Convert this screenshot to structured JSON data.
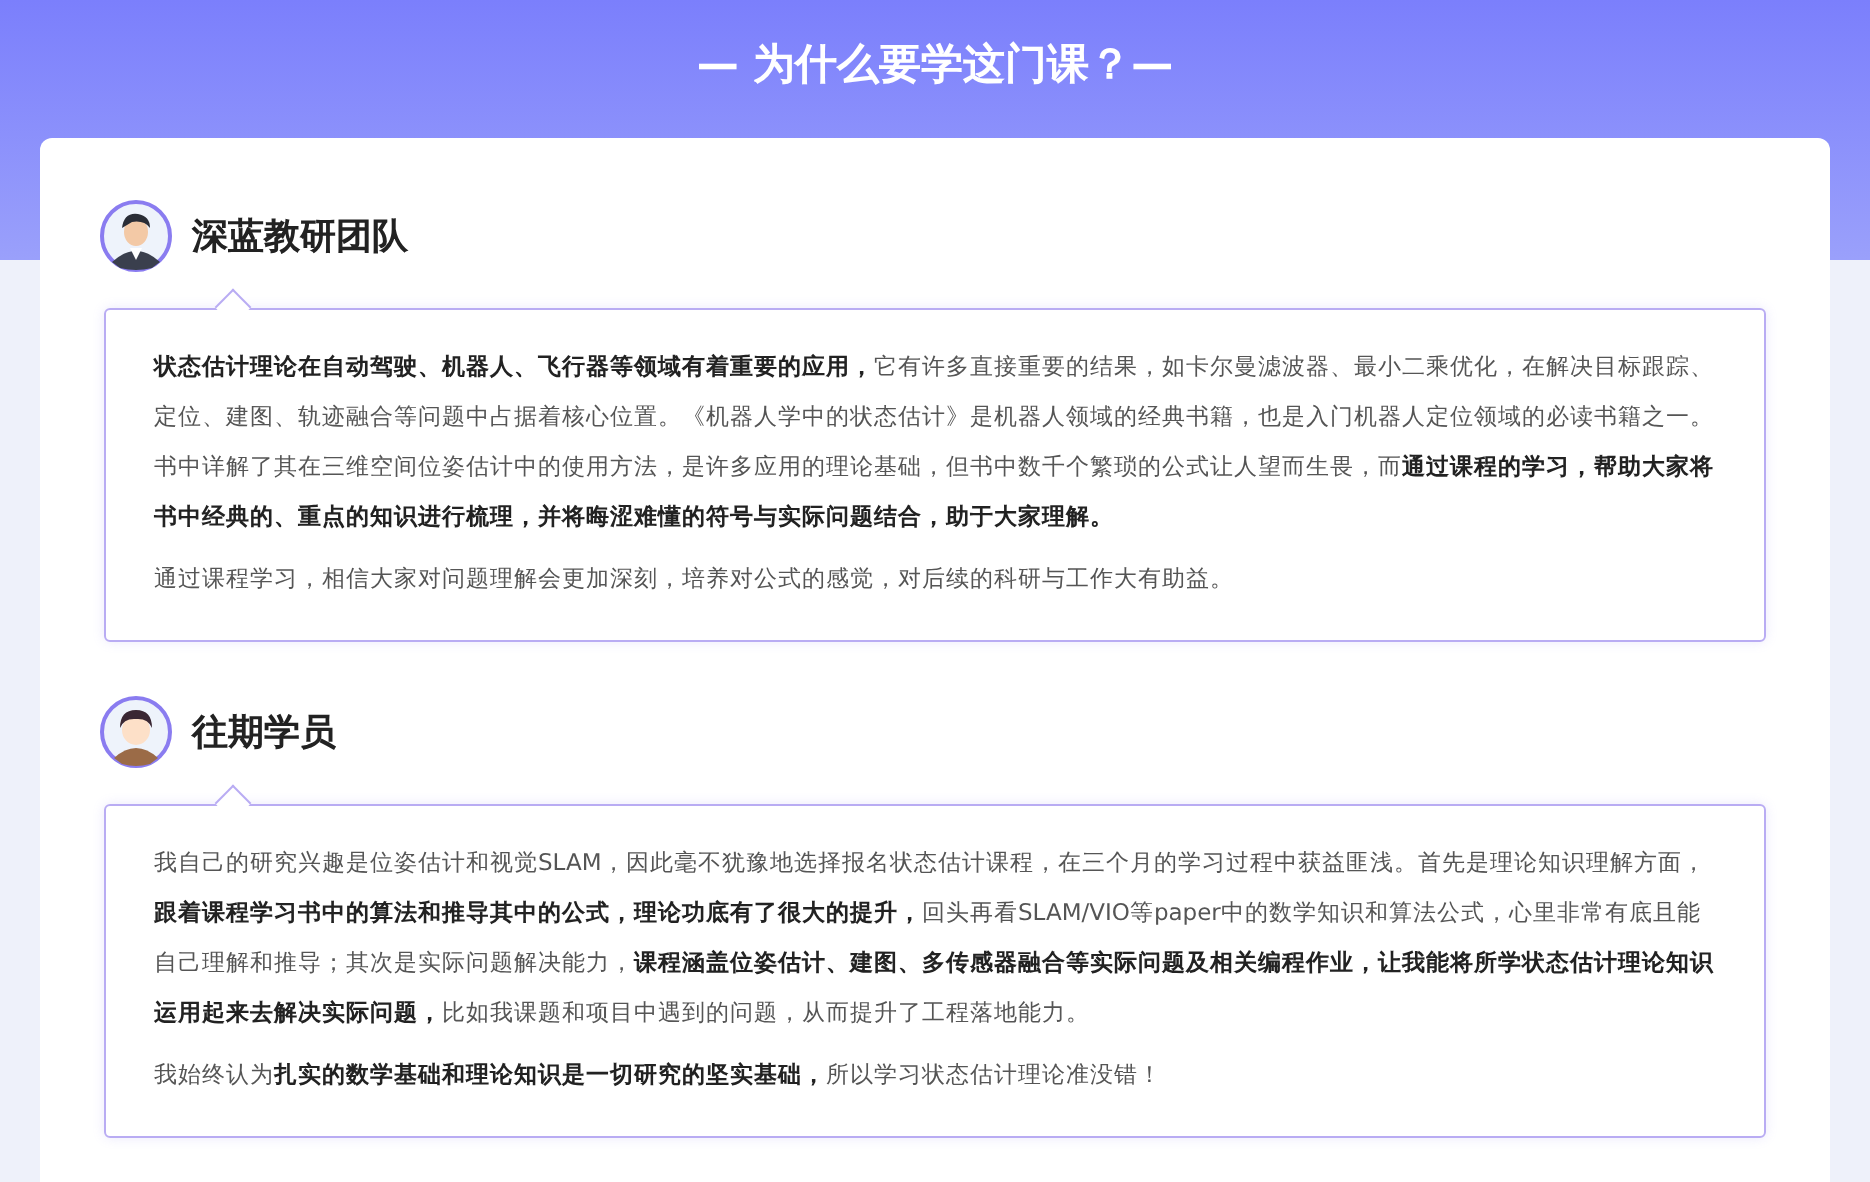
{
  "heading": "— 为什么要学这门课？—",
  "sections": [
    {
      "name": "深蓝教研团队",
      "kind": "teacher",
      "paragraphs": [
        "**状态估计理论在自动驾驶、机器人、飞行器等领域有着重要的应用，**它有许多直接重要的结果，如卡尔曼滤波器、最小二乘优化，在解决目标跟踪、定位、建图、轨迹融合等问题中占据着核心位置。《机器人学中的状态估计》是机器人领域的经典书籍，也是入门机器人定位领域的必读书籍之一。书中详解了其在三维空间位姿估计中的使用方法，是许多应用的理论基础，但书中数千个繁琐的公式让人望而生畏，而**通过课程的学习，帮助大家将书中经典的、重点的知识进行梳理，并将晦涩难懂的符号与实际问题结合，助于大家理解。**",
        "通过课程学习，相信大家对问题理解会更加深刻，培养对公式的感觉，对后续的科研与工作大有助益。"
      ]
    },
    {
      "name": "往期学员",
      "kind": "student",
      "paragraphs": [
        "我自己的研究兴趣是位姿估计和视觉SLAM，因此毫不犹豫地选择报名状态估计课程，在三个月的学习过程中获益匪浅。首先是理论知识理解方面，**跟着课程学习书中的算法和推导其中的公式，理论功底有了很大的提升，**回头再看SLAM/VIO等paper中的数学知识和算法公式，心里非常有底且能自己理解和推导；其次是实际问题解决能力，**课程涵盖位姿估计、建图、多传感器融合等实际问题及相关编程作业，让我能将所学状态估计理论知识运用起来去解决实际问题，**比如我课题和项目中遇到的问题，从而提升了工程落地能力。",
        "我始终认为**扎实的数学基础和理论知识是一切研究的坚实基础，**所以学习状态估计理论准没错！"
      ]
    }
  ]
}
